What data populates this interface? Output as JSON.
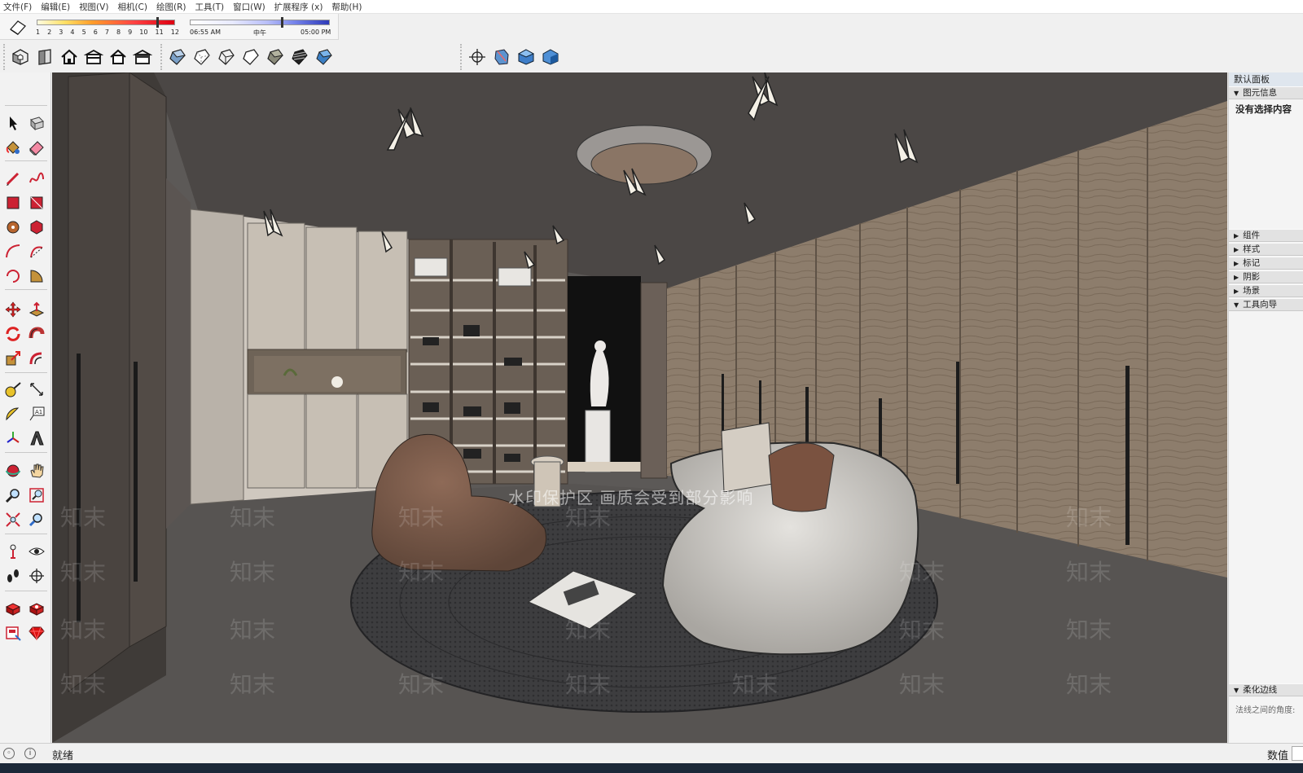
{
  "menu": [
    "文件(F)",
    "编辑(E)",
    "视图(V)",
    "相机(C)",
    "绘图(R)",
    "工具(T)",
    "窗口(W)",
    "扩展程序 (x)",
    "帮助(H)"
  ],
  "shadow": {
    "months": [
      "1",
      "2",
      "3",
      "4",
      "5",
      "6",
      "7",
      "8",
      "9",
      "10",
      "11",
      "12"
    ],
    "time_start": "06:55 AM",
    "time_mid": "中午",
    "time_end": "05:00 PM"
  },
  "toolbar_icons": {
    "views": [
      "iso-view-icon",
      "top-view-icon",
      "front-view-icon",
      "right-view-icon",
      "back-view-icon",
      "left-view-icon"
    ],
    "styles": [
      "xray-style-icon",
      "back-edges-style-icon",
      "wireframe-style-icon",
      "hidden-line-style-icon",
      "shaded-style-icon",
      "shaded-textures-style-icon",
      "monochrome-style-icon"
    ],
    "sections": [
      "section-plane-icon",
      "display-section-planes-icon",
      "display-section-cuts-icon",
      "display-section-fill-icon"
    ]
  },
  "left_tools": [
    "select-icon",
    "make-component-icon",
    "paint-bucket-icon",
    "eraser-icon",
    "line-icon",
    "freehand-icon",
    "rectangle-icon",
    "rotated-rectangle-icon",
    "circle-icon",
    "polygon-icon",
    "arc-icon",
    "two-point-arc-icon",
    "three-point-arc-icon",
    "pie-icon",
    "move-icon",
    "push-pull-icon",
    "rotate-icon",
    "follow-me-icon",
    "scale-icon",
    "offset-icon",
    "tape-measure-icon",
    "dimension-icon",
    "protractor-icon",
    "text-icon",
    "axes-icon",
    "3d-text-icon",
    "orbit-icon",
    "pan-icon",
    "zoom-icon",
    "zoom-window-icon",
    "zoom-extents-icon",
    "previous-view-icon",
    "position-camera-icon",
    "look-around-icon",
    "walk-icon",
    "section-plane-icon",
    "warehouse-icon",
    "extension-warehouse-icon",
    "layout-icon",
    "ruby-icon"
  ],
  "viewport": {
    "watermark_text": "水印保护区  画质会受到部分影响",
    "watermark_logo": "知末"
  },
  "tray": {
    "title": "默认面板",
    "entity_info": "图元信息",
    "no_selection": "没有选择内容",
    "panels": [
      "组件",
      "样式",
      "标记",
      "阴影",
      "场景",
      "工具向导"
    ],
    "soften_edges": "柔化边线",
    "soften_angle": "法线之间的角度:"
  },
  "status": {
    "text": "就绪",
    "vcb_label": "数值"
  }
}
